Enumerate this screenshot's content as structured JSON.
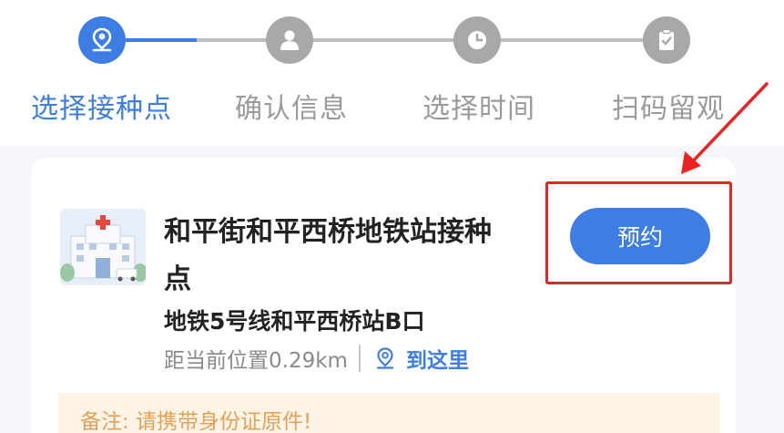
{
  "stepper": {
    "steps": [
      {
        "label": "选择接种点",
        "icon": "location-person-icon",
        "active": true
      },
      {
        "label": "确认信息",
        "icon": "user-icon",
        "active": false
      },
      {
        "label": "选择时间",
        "icon": "clock-icon",
        "active": false
      },
      {
        "label": "扫码留观",
        "icon": "clipboard-check-icon",
        "active": false
      }
    ]
  },
  "site": {
    "name": "和平街和平西桥地铁站接种点",
    "address": "地铁5号线和平西桥站B口",
    "distance": "距当前位置0.29km",
    "navigate_label": "到这里",
    "book_label": "预约",
    "note": "备注: 请携带身份证原件!"
  },
  "colors": {
    "accent": "#3d7de4",
    "inactive": "#a8a8a8",
    "annotation": "#ee2222",
    "note_bg": "#fdf4e6"
  }
}
